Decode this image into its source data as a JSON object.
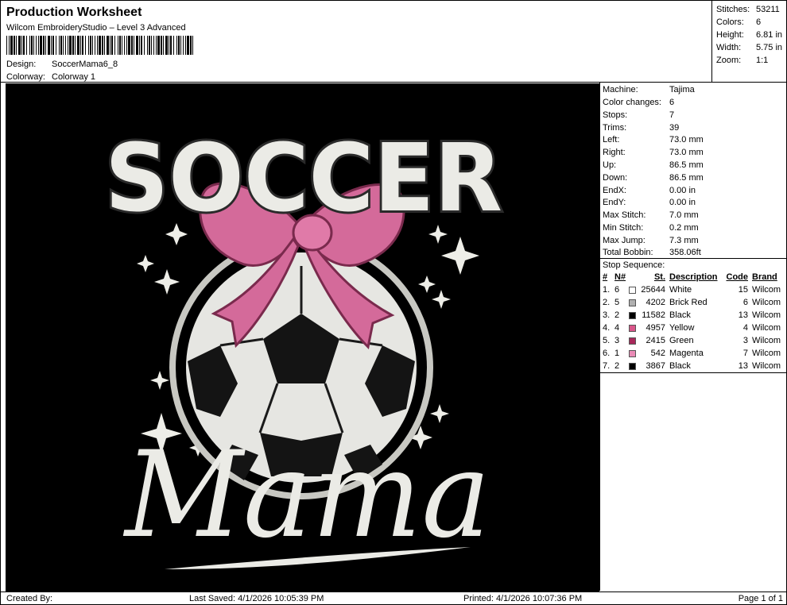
{
  "header": {
    "title": "Production Worksheet",
    "subtitle": "Wilcom EmbroideryStudio – Level 3 Advanced",
    "design_label": "Design:",
    "design_value": "SoccerMama6_8",
    "colorway_label": "Colorway:",
    "colorway_value": "Colorway 1"
  },
  "stats": [
    {
      "label": "Stitches:",
      "value": "53211"
    },
    {
      "label": "Colors:",
      "value": "6"
    },
    {
      "label": "Height:",
      "value": "6.81 in"
    },
    {
      "label": "Width:",
      "value": "5.75 in"
    },
    {
      "label": "Zoom:",
      "value": "1:1"
    }
  ],
  "design": {
    "top_text": "SOCCER",
    "script_text": "Mama",
    "colors": {
      "background": "#000000",
      "white": "#f2f2ee",
      "pink": "#d46a9a",
      "ball_black": "#111111",
      "outline": "#555555"
    }
  },
  "info": [
    {
      "label": "Machine:",
      "value": "Tajima"
    },
    {
      "label": "Color changes:",
      "value": "6"
    },
    {
      "label": "Stops:",
      "value": "7"
    },
    {
      "label": "Trims:",
      "value": "39"
    },
    {
      "label": "Left:",
      "value": "73.0 mm"
    },
    {
      "label": "Right:",
      "value": "73.0 mm"
    },
    {
      "label": "Up:",
      "value": "86.5 mm"
    },
    {
      "label": "Down:",
      "value": "86.5 mm"
    },
    {
      "label": "EndX:",
      "value": "0.00 in"
    },
    {
      "label": "EndY:",
      "value": "0.00 in"
    },
    {
      "label": "Max Stitch:",
      "value": "7.0 mm"
    },
    {
      "label": "Min Stitch:",
      "value": "0.2 mm"
    },
    {
      "label": "Max Jump:",
      "value": "7.3 mm"
    },
    {
      "label": "Total Bobbin:",
      "value": "358.06ft"
    }
  ],
  "stop_sequence": {
    "title": "Stop Sequence:",
    "headers": {
      "idx": "#",
      "n": "N#",
      "st": "St.",
      "desc": "Description",
      "code": "Code",
      "brand": "Brand"
    },
    "rows": [
      {
        "idx": "1.",
        "n": "6",
        "color": "#ffffff",
        "st": "25644",
        "desc": "White",
        "code": "15",
        "brand": "Wilcom"
      },
      {
        "idx": "2.",
        "n": "5",
        "color": "#b0b0b0",
        "st": "4202",
        "desc": "Brick Red",
        "code": "6",
        "brand": "Wilcom"
      },
      {
        "idx": "3.",
        "n": "2",
        "color": "#000000",
        "st": "11582",
        "desc": "Black",
        "code": "13",
        "brand": "Wilcom"
      },
      {
        "idx": "4.",
        "n": "4",
        "color": "#d9568a",
        "st": "4957",
        "desc": "Yellow",
        "code": "4",
        "brand": "Wilcom"
      },
      {
        "idx": "5.",
        "n": "3",
        "color": "#a8285a",
        "st": "2415",
        "desc": "Green",
        "code": "3",
        "brand": "Wilcom"
      },
      {
        "idx": "6.",
        "n": "1",
        "color": "#e98bb6",
        "st": "542",
        "desc": "Magenta",
        "code": "7",
        "brand": "Wilcom"
      },
      {
        "idx": "7.",
        "n": "2",
        "color": "#000000",
        "st": "3867",
        "desc": "Black",
        "code": "13",
        "brand": "Wilcom"
      }
    ]
  },
  "footer": {
    "created": "Created By:",
    "saved": "Last Saved: 4/1/2026 10:05:39 PM",
    "printed": "Printed: 4/1/2026 10:07:36 PM",
    "page": "Page 1 of 1"
  }
}
